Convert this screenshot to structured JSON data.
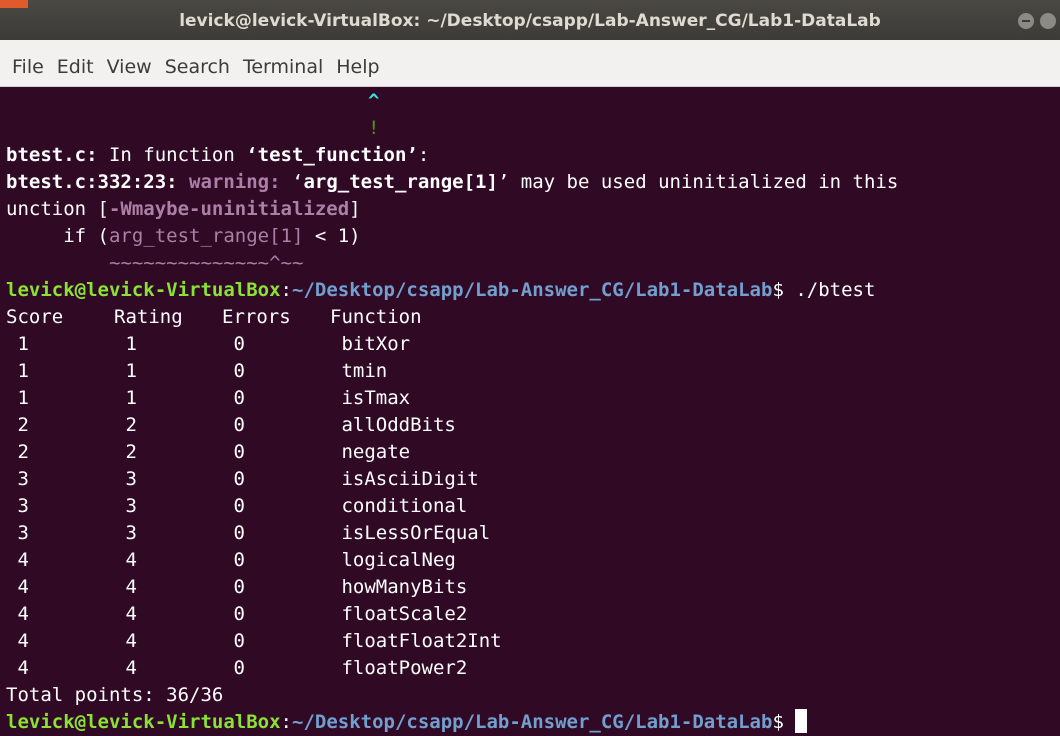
{
  "window": {
    "title": "levick@levick-VirtualBox: ~/Desktop/csapp/Lab-Answer_CG/Lab1-DataLab"
  },
  "menu": [
    "File",
    "Edit",
    "View",
    "Search",
    "Terminal",
    "Help"
  ],
  "terminal": {
    "caret_line": "^",
    "bang_line": "!",
    "fn_file": "btest.c:",
    "fn_text": " In function ",
    "fn_name": "‘test_function’",
    "fn_colon": ":",
    "warn_loc": "btest.c:332:23:",
    "warn_label": "warning:",
    "warn_quote_open": " ‘",
    "warn_var": "arg_test_range[1]",
    "warn_msg": "’ may be used uninitialized in this",
    "wrap_prefix": "unction [",
    "wrap_flag": "-Wmaybe-uninitialized",
    "wrap_suffix": "]",
    "code_prefix": "     if (",
    "code_var": "arg_test_range[1]",
    "code_suffix": " < 1)",
    "tilde_line": "         ~~~~~~~~~~~~~~^~~",
    "prompt_user": "levick@levick-VirtualBox",
    "prompt_sep": ":",
    "prompt_path": "~/Desktop/csapp/Lab-Answer_CG/Lab1-DataLab",
    "prompt_dollar": "$ ",
    "command": "./btest",
    "headers": [
      "Score",
      "Rating",
      "Errors",
      "Function"
    ],
    "rows": [
      [
        "1",
        "1",
        "0",
        "bitXor"
      ],
      [
        "1",
        "1",
        "0",
        "tmin"
      ],
      [
        "1",
        "1",
        "0",
        "isTmax"
      ],
      [
        "2",
        "2",
        "0",
        "allOddBits"
      ],
      [
        "2",
        "2",
        "0",
        "negate"
      ],
      [
        "3",
        "3",
        "0",
        "isAsciiDigit"
      ],
      [
        "3",
        "3",
        "0",
        "conditional"
      ],
      [
        "3",
        "3",
        "0",
        "isLessOrEqual"
      ],
      [
        "4",
        "4",
        "0",
        "logicalNeg"
      ],
      [
        "4",
        "4",
        "0",
        "howManyBits"
      ],
      [
        "4",
        "4",
        "0",
        "floatScale2"
      ],
      [
        "4",
        "4",
        "0",
        "floatFloat2Int"
      ],
      [
        "4",
        "4",
        "0",
        "floatPower2"
      ]
    ],
    "total": "Total points: 36/36"
  }
}
